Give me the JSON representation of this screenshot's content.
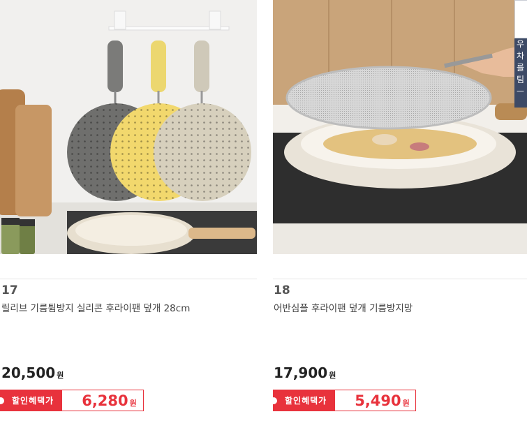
{
  "products": [
    {
      "rank": "17",
      "name": "릴리브 기름튐방지 실리콘 후라이팬 덮개 28cm",
      "price": "20,500",
      "price_unit": "원",
      "promo_label": "할인혜택가",
      "promo_price": "6,280",
      "promo_unit": "원"
    },
    {
      "rank": "18",
      "name": "어반심플 후라이팬 덮개 기름방지망",
      "price": "17,900",
      "price_unit": "원",
      "promo_label": "할인혜택가",
      "promo_price": "5,490",
      "promo_unit": "원"
    }
  ],
  "side_panel": {
    "chars": [
      "우",
      "차",
      "를",
      "팀"
    ],
    "bottom_char": "ㅡ"
  },
  "colors": {
    "accent_red": "#e8323c",
    "side_panel_navy": "#3d4a66"
  }
}
